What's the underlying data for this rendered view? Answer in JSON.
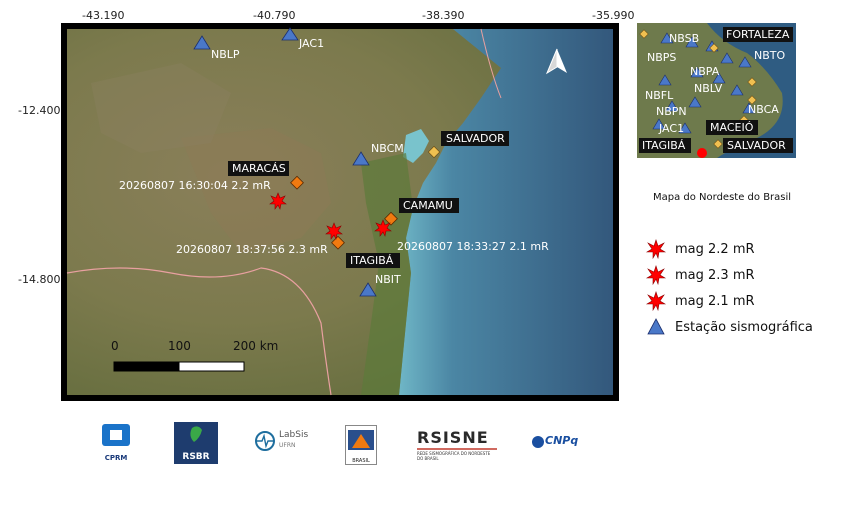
{
  "map": {
    "lon_ticks": [
      "-43.190",
      "-40.790",
      "-38.390",
      "-35.990"
    ],
    "lat_ticks": [
      "-12.400",
      "-14.800"
    ],
    "places": [
      {
        "name": "NBLP",
        "kind": "station"
      },
      {
        "name": "JAC1",
        "kind": "station"
      },
      {
        "name": "NBCM",
        "kind": "station"
      },
      {
        "name": "NBIT",
        "kind": "station"
      },
      {
        "name": "SALVADOR",
        "kind": "city"
      },
      {
        "name": "MARACÁS",
        "kind": "city"
      },
      {
        "name": "CAMAMU",
        "kind": "city"
      },
      {
        "name": "ITAGIBÁ",
        "kind": "city"
      }
    ],
    "events": [
      {
        "label": "20260807 16:30:04 2.2 mR",
        "mag": 2.2
      },
      {
        "label": "20260807 18:37:56 2.3 mR",
        "mag": 2.3
      },
      {
        "label": "20260807 18:33:27 2.1 mR",
        "mag": 2.1
      }
    ],
    "scale_bar": {
      "labels": [
        "0",
        "100",
        "200 km"
      ]
    },
    "north_arrow": "north-arrow-icon",
    "colors": {
      "land": "#7d7a4e",
      "sea": "#3e6d92",
      "coast_sea": "#9ad0d8",
      "station": "#4a78c8",
      "city": "#f0c050",
      "event": "#ff0000"
    }
  },
  "inset": {
    "caption": "Mapa do Nordeste do Brasil",
    "labels": [
      "NBSB",
      "FORTALEZA",
      "NBPS",
      "NBTO",
      "NBPA",
      "NBLV",
      "NBFL",
      "NBPN",
      "NBCA",
      "JAC1",
      "MACEIÓ",
      "ITAGIBÁ",
      "SALVADOR"
    ]
  },
  "legend": {
    "items": [
      {
        "label": "mag 2.2 mR",
        "symbol": "star-burst-icon"
      },
      {
        "label": "mag 2.3 mR",
        "symbol": "star-burst-icon"
      },
      {
        "label": "mag 2.1 mR",
        "symbol": "star-burst-icon"
      },
      {
        "label": "Estação sismográfica",
        "symbol": "triangle-icon"
      }
    ]
  },
  "logos": [
    {
      "name": "CPRM",
      "text": "CPRM"
    },
    {
      "name": "RSBR",
      "text": "RSBR"
    },
    {
      "name": "LabSis",
      "text": "LabSis",
      "sub": "UFRN"
    },
    {
      "name": "UFRN-BRASIL",
      "text": "BRASIL"
    },
    {
      "name": "RSISNE",
      "text": "RSISNE",
      "sub": "REDE SISMOGRÁFICA DO NORDESTE DO BRASIL"
    },
    {
      "name": "CNPq",
      "text": "CNPq"
    }
  ]
}
